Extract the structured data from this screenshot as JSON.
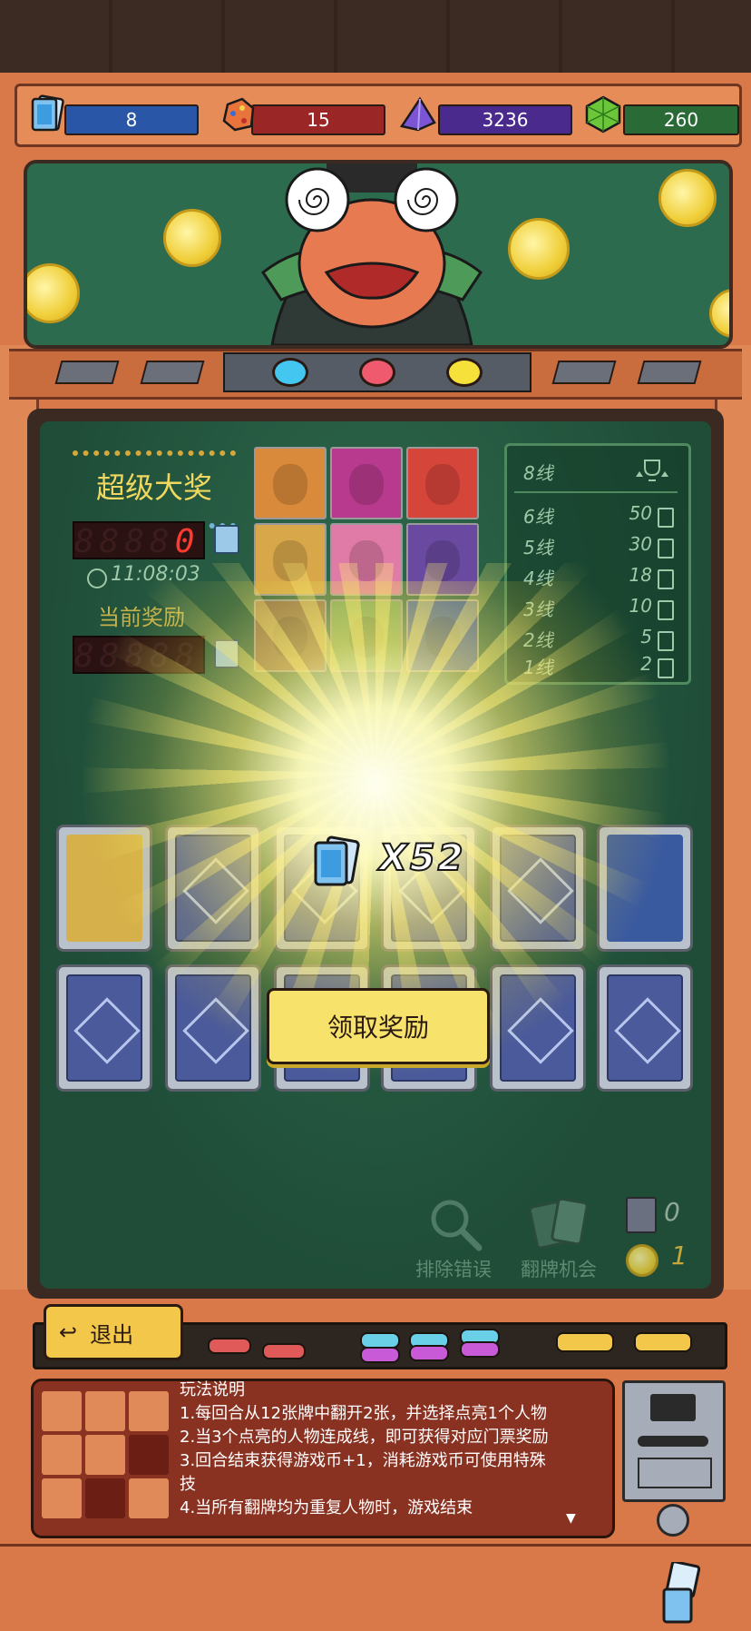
{
  "resources": {
    "tickets": "8",
    "gems_red": "15",
    "crystals": "3236",
    "emeralds": "260"
  },
  "jackpot": {
    "title": "超级大奖",
    "jackpot_value": "0",
    "timer": "11:08:03",
    "current_reward_label": "当前奖励",
    "current_reward_value": ""
  },
  "payout_table": {
    "rows": [
      {
        "label": "8线",
        "value": ""
      },
      {
        "label": "6线",
        "value": "50"
      },
      {
        "label": "5线",
        "value": "30"
      },
      {
        "label": "4线",
        "value": "18"
      },
      {
        "label": "3线",
        "value": "10"
      },
      {
        "label": "2线",
        "value": "5"
      },
      {
        "label": "1线",
        "value": "2"
      }
    ]
  },
  "reward_popup": {
    "count": "X52",
    "claim_label": "领取奖励"
  },
  "tools": {
    "remove_error_label": "排除错误",
    "flip_chance_label": "翻牌机会",
    "card_count": "0",
    "coin_count": "1"
  },
  "exit_label": "退出",
  "rules": {
    "title": "玩法说明",
    "line1": "1.每回合从12张牌中翻开2张，并选择点亮1个人物",
    "line2": "2.当3个点亮的人物连成线，即可获得对应门票奖励",
    "line3": "3.回合结束获得游戏币+1，消耗游戏币可使用特殊",
    "line3b": "技",
    "line4": "4.当所有翻牌均为重复人物时，游戏结束"
  },
  "colors": {
    "cabinet": "#d9794a",
    "panel_green": "#1f4d38",
    "led_red": "#ff3b2f",
    "claim_button": "#f7e26b"
  }
}
